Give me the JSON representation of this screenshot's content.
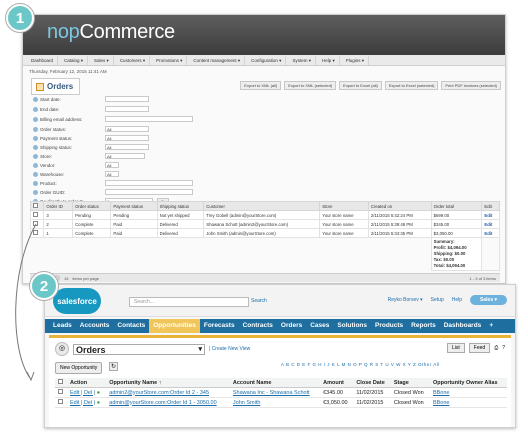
{
  "badges": {
    "one": "1",
    "two": "2"
  },
  "nop": {
    "logo_a": "nop",
    "logo_b": "Commerce",
    "menu": [
      "Dashboard",
      "Catalog ▾",
      "Sales ▾",
      "Customers ▾",
      "Promotions ▾",
      "Content management ▾",
      "Configuration ▾",
      "System ▾",
      "Help ▾",
      "Plugins ▾"
    ],
    "date": "Thursday, February 12, 2015 11:41 AM",
    "title": "Orders",
    "exports": [
      "Export to XML (all)",
      "Export to XML (selected)",
      "Export to Excel (all)",
      "Export to Excel (selected)",
      "Print PDF invoices (selected)"
    ],
    "filters": [
      {
        "label": "Start date:",
        "value": ""
      },
      {
        "label": "End date:",
        "value": ""
      },
      {
        "label": "Billing email address:",
        "value": ""
      },
      {
        "label": "Order status:",
        "value": "All"
      },
      {
        "label": "Payment status:",
        "value": "All"
      },
      {
        "label": "Shipping status:",
        "value": "All"
      },
      {
        "label": "Store:",
        "value": "All"
      },
      {
        "label": "Vendor:",
        "value": "All"
      },
      {
        "label": "Warehouse:",
        "value": "All"
      },
      {
        "label": "Product:",
        "value": ""
      },
      {
        "label": "Order GUID:",
        "value": ""
      },
      {
        "label": "Go directly to order #:",
        "value": "0"
      }
    ],
    "go_label": "Go",
    "search_label": "Search",
    "columns": [
      "",
      "Order ID",
      "Order status",
      "Payment status",
      "Shipping status",
      "Customer",
      "Store",
      "Created on",
      "Order total",
      "Edit"
    ],
    "rows": [
      [
        "3",
        "Pending",
        "Pending",
        "Not yet shipped",
        "Trey Gobell (admin@yourStore.com)",
        "Your store name",
        "2/11/2015 5:42:24 PM",
        "$699.00",
        "Edit"
      ],
      [
        "2",
        "Complete",
        "Paid",
        "Delivered",
        "Shawana Schott (admin2@yourStore.com)",
        "Your store name",
        "2/11/2015 5:39:48 PM",
        "$345.00",
        "Edit"
      ],
      [
        "1",
        "Complete",
        "Paid",
        "Delivered",
        "John Smith (admin@yourStore.com)",
        "Your store name",
        "2/11/2015 5:34:35 PM",
        "$3,050.00",
        "Edit"
      ]
    ],
    "summary": [
      "Summary:",
      "Profit: $4,094.00",
      "Shipping: $0.00",
      "Tax: $0.00",
      "Total: $4,094.00"
    ],
    "pager_page": "1",
    "pager_size": "15",
    "pager_label": "items per page",
    "pager_info": "1 - 3 of 3 items"
  },
  "sf": {
    "logo": "salesforce",
    "search_placeholder": "Search...",
    "search_button": "Search",
    "user": "Reyko Borsev ▾",
    "setup": "Setup",
    "help": "Help",
    "app": "Sales ▾",
    "tabs": [
      "Leads",
      "Accounts",
      "Contacts",
      "Opportunities",
      "Forecasts",
      "Contracts",
      "Orders",
      "Cases",
      "Solutions",
      "Products",
      "Reports",
      "Dashboards",
      "+"
    ],
    "view_name": "Orders",
    "create_view": "| Create New View",
    "list_btn": "List",
    "feed_btn": "Feed",
    "new_opp": "New Opportunity",
    "letters": "A B C D E F G H I J K L M N O P Q R S T U V W X Y Z Other All",
    "columns": [
      "",
      "Action",
      "Opportunity Name ↑",
      "Account Name",
      "Amount",
      "Close Date",
      "Stage",
      "Opportunity Owner Alias"
    ],
    "rows": [
      [
        "Edit | Del |",
        "admin2@yourStore.com:Order Id 2 - 345",
        "Shawana Inc - Shawana Schott",
        "€345.00",
        "11/02/2015",
        "Closed Won",
        "BBone"
      ],
      [
        "Edit | Del |",
        "admin@yourStore.com:Order Id 1 - 3050.00",
        "John Smith",
        "€3,050.00",
        "11/02/2015",
        "Closed Won",
        "BBone"
      ]
    ]
  }
}
